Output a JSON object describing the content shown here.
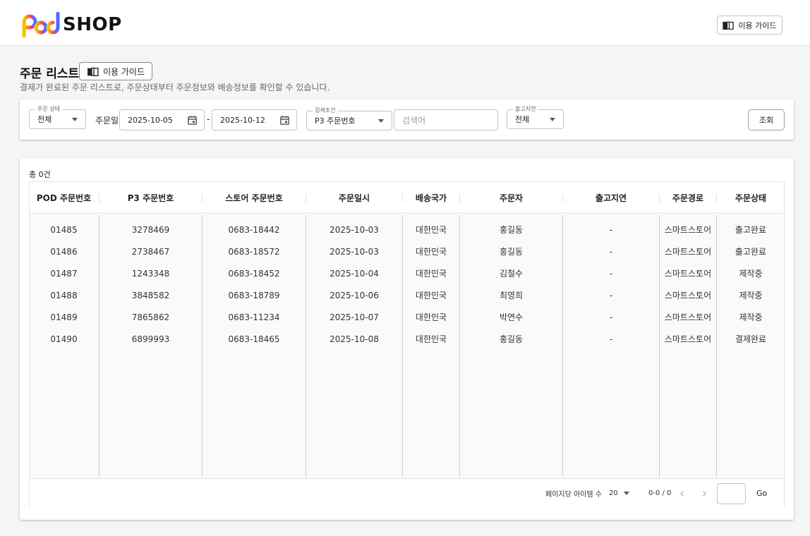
{
  "header": {
    "logo_text": "SHOP",
    "guide_label": "이용 가이드"
  },
  "page": {
    "title": "주문 리스트",
    "guide_label": "이용 가이드",
    "subtitle": "결제가 완료된 주문 리스트로, 주문상태부터 주문정보와 배송정보를 확인할 수 있습니다."
  },
  "filters": {
    "order_status": {
      "legend": "주문 상태",
      "value": "전체"
    },
    "order_date_label": "주문일",
    "date_from": "2025-10-05",
    "date_separator": "-",
    "date_to": "2025-10-12",
    "search_condition": {
      "legend": "검색조건",
      "value": "P3 주문번호"
    },
    "search_placeholder": "검색어",
    "shipping_delay": {
      "legend": "출고지연",
      "value": "전체"
    },
    "search_button": "조회"
  },
  "table": {
    "total_label": "총 0건",
    "columns": [
      "POD 주문번호",
      "P3 주문번호",
      "스토어 주문번호",
      "주문일시",
      "배송국가",
      "주문자",
      "출고지연",
      "주문경로",
      "주문상태"
    ],
    "rows": [
      [
        "01485",
        "3278469",
        "0683-18442",
        "2025-10-03",
        "대한민국",
        "홍길동",
        "-",
        "스마트스토어",
        "출고완료"
      ],
      [
        "01486",
        "2738467",
        "0683-18572",
        "2025-10-03",
        "대한민국",
        "홍길동",
        "-",
        "스마트스토어",
        "출고완료"
      ],
      [
        "01487",
        "1243348",
        "0683-18452",
        "2025-10-04",
        "대한민국",
        "김철수",
        "-",
        "스마트스토어",
        "제작중"
      ],
      [
        "01488",
        "3848582",
        "0683-18789",
        "2025-10-06",
        "대한민국",
        "최영희",
        "-",
        "스마트스토어",
        "제작중"
      ],
      [
        "01489",
        "7865862",
        "0683-11234",
        "2025-10-07",
        "대한민국",
        "박연수",
        "-",
        "스마트스토어",
        "제작중"
      ],
      [
        "01490",
        "6899993",
        "0683-18465",
        "2025-10-08",
        "대한민국",
        "홍길동",
        "-",
        "스마트스토어",
        "결제완료"
      ]
    ]
  },
  "pagination": {
    "per_page_label": "페이지당 아이템 수",
    "per_page_value": "20",
    "range": "0-0 / 0",
    "go_label": "Go"
  },
  "colors": {
    "logo_gradient": [
      "#f7c600",
      "#ff7a1a",
      "#ff3d6e",
      "#8a4dff",
      "#2f7bff"
    ]
  }
}
